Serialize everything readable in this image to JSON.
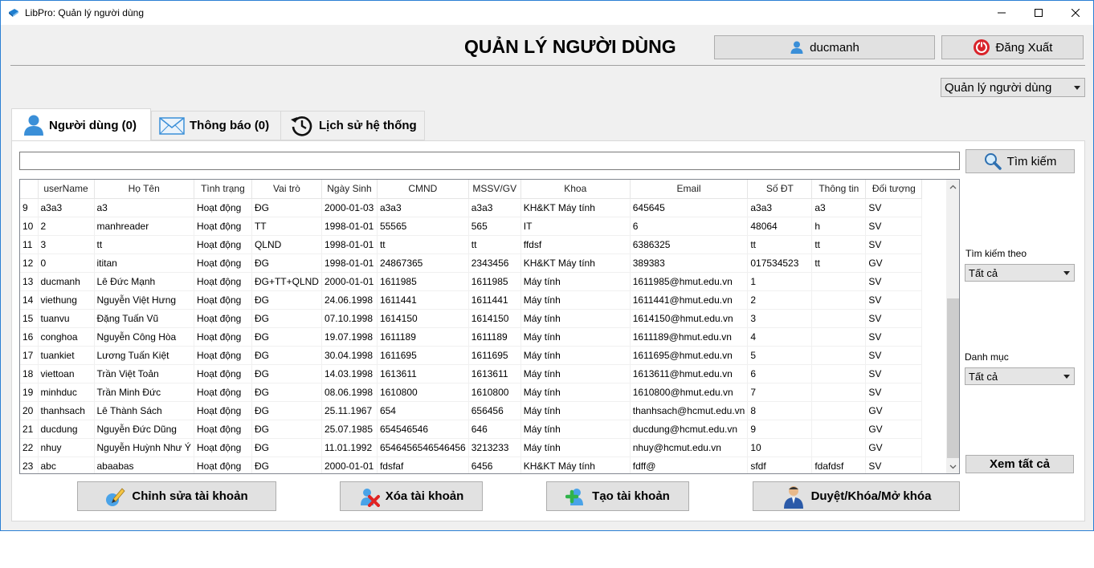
{
  "window": {
    "title": "LibPro: Quản lý người dùng"
  },
  "header": {
    "title": "QUẢN LÝ NGƯỜI DÙNG",
    "username": "ducmanh",
    "logout_label": "Đăng Xuất",
    "module_select": "Quản lý người dùng"
  },
  "tabs": [
    {
      "label": "Người dùng (0)",
      "icon": "user-icon",
      "active": true
    },
    {
      "label": "Thông báo (0)",
      "icon": "envelope-icon",
      "active": false
    },
    {
      "label": "Lịch sử hệ thống",
      "icon": "history-icon",
      "active": false
    }
  ],
  "search": {
    "value": "",
    "button_label": "Tìm kiếm"
  },
  "table": {
    "columns": [
      "",
      "userName",
      "Họ Tên",
      "Tình trạng",
      "Vai trò",
      "Ngày Sinh",
      "CMND",
      "MSSV/GV",
      "Khoa",
      "Email",
      "Số ĐT",
      "Thông tin",
      "Đối tượng"
    ],
    "rows": [
      [
        "9",
        "a3a3",
        "a3",
        "Hoạt động",
        "ĐG",
        "2000-01-03",
        "a3a3",
        "a3a3",
        "KH&KT Máy tính",
        "645645",
        "a3a3",
        "a3",
        "SV"
      ],
      [
        "10",
        "2",
        "manhreader",
        "Hoạt động",
        "TT",
        "1998-01-01",
        "55565",
        "565",
        "IT",
        "6",
        "48064",
        "h",
        "SV"
      ],
      [
        "11",
        "3",
        "tt",
        "Hoạt động",
        "QLND",
        "1998-01-01",
        "tt",
        "tt",
        "ffdsf",
        "6386325",
        "tt",
        "tt",
        "SV"
      ],
      [
        "12",
        "0",
        "ititan",
        "Hoạt động",
        "ĐG",
        "1998-01-01",
        "24867365",
        "2343456",
        "KH&KT Máy tính",
        "389383",
        "017534523",
        "tt",
        "GV"
      ],
      [
        "13",
        "ducmanh",
        "Lê Đức Mạnh",
        "Hoạt động",
        "ĐG+TT+QLND",
        "2000-01-01",
        "1611985",
        "1611985",
        "Máy tính",
        "1611985@hmut.edu.vn",
        "1",
        "",
        "SV"
      ],
      [
        "14",
        "viethung",
        "Nguyễn Việt Hưng",
        "Hoạt động",
        "ĐG",
        "24.06.1998",
        "1611441",
        "1611441",
        "Máy tính",
        "1611441@hmut.edu.vn",
        "2",
        "",
        "SV"
      ],
      [
        "15",
        "tuanvu",
        "Đặng Tuấn Vũ",
        "Hoạt động",
        "ĐG",
        "07.10.1998",
        "1614150",
        "1614150",
        "Máy tính",
        "1614150@hmut.edu.vn",
        "3",
        "",
        "SV"
      ],
      [
        "16",
        "conghoa",
        "Nguyễn Công Hòa",
        "Hoạt động",
        "ĐG",
        "19.07.1998",
        "1611189",
        "1611189",
        "Máy tính",
        "1611189@hmut.edu.vn",
        "4",
        "",
        "SV"
      ],
      [
        "17",
        "tuankiet",
        "Lương Tuấn Kiệt",
        "Hoạt động",
        "ĐG",
        "30.04.1998",
        "1611695",
        "1611695",
        "Máy tính",
        "1611695@hmut.edu.vn",
        "5",
        "",
        "SV"
      ],
      [
        "18",
        "viettoan",
        "Trần Việt Toản",
        "Hoạt động",
        "ĐG",
        "14.03.1998",
        "1613611",
        "1613611",
        "Máy tính",
        "1613611@hmut.edu.vn",
        "6",
        "",
        "SV"
      ],
      [
        "19",
        "minhduc",
        "Trần Minh Đức",
        "Hoạt động",
        "ĐG",
        "08.06.1998",
        "1610800",
        "1610800",
        "Máy tính",
        "1610800@hmut.edu.vn",
        "7",
        "",
        "SV"
      ],
      [
        "20",
        "thanhsach",
        "Lê Thành Sách",
        "Hoạt động",
        "ĐG",
        "25.11.1967",
        "654",
        "656456",
        "Máy tính",
        "thanhsach@hcmut.edu.vn",
        "8",
        "",
        "GV"
      ],
      [
        "21",
        "ducdung",
        "Nguyễn Đức Dũng",
        "Hoạt động",
        "ĐG",
        "25.07.1985",
        "654546546",
        "646",
        "Máy tính",
        "ducdung@hcmut.edu.vn",
        "9",
        "",
        "GV"
      ],
      [
        "22",
        "nhuy",
        "Nguyễn Huỳnh Như Ý",
        "Hoạt động",
        "ĐG",
        "11.01.1992",
        "6546456546546456",
        "3213233",
        "Máy tính",
        "nhuy@hcmut.edu.vn",
        "10",
        "",
        "GV"
      ],
      [
        "23",
        "abc",
        "abaabas",
        "Hoạt động",
        "ĐG",
        "2000-01-01",
        "fdsfaf",
        "6456",
        "KH&KT Máy tính",
        "fdff@",
        "sfdf",
        "fdafdsf",
        "SV"
      ]
    ]
  },
  "filters": {
    "search_by_label": "Tìm kiếm theo",
    "search_by_value": "Tất cả",
    "category_label": "Danh mục",
    "category_value": "Tất cả",
    "view_all_label": "Xem tất cả"
  },
  "actions": {
    "edit_label": "Chỉnh sửa tài khoản",
    "delete_label": "Xóa tài khoản",
    "create_label": "Tạo tài khoản",
    "approve_label": "Duyệt/Khóa/Mở khóa"
  },
  "colors": {
    "window_border": "#2b7fd4",
    "logout_red": "#d9232a",
    "user_blue": "#3a8fd8"
  }
}
